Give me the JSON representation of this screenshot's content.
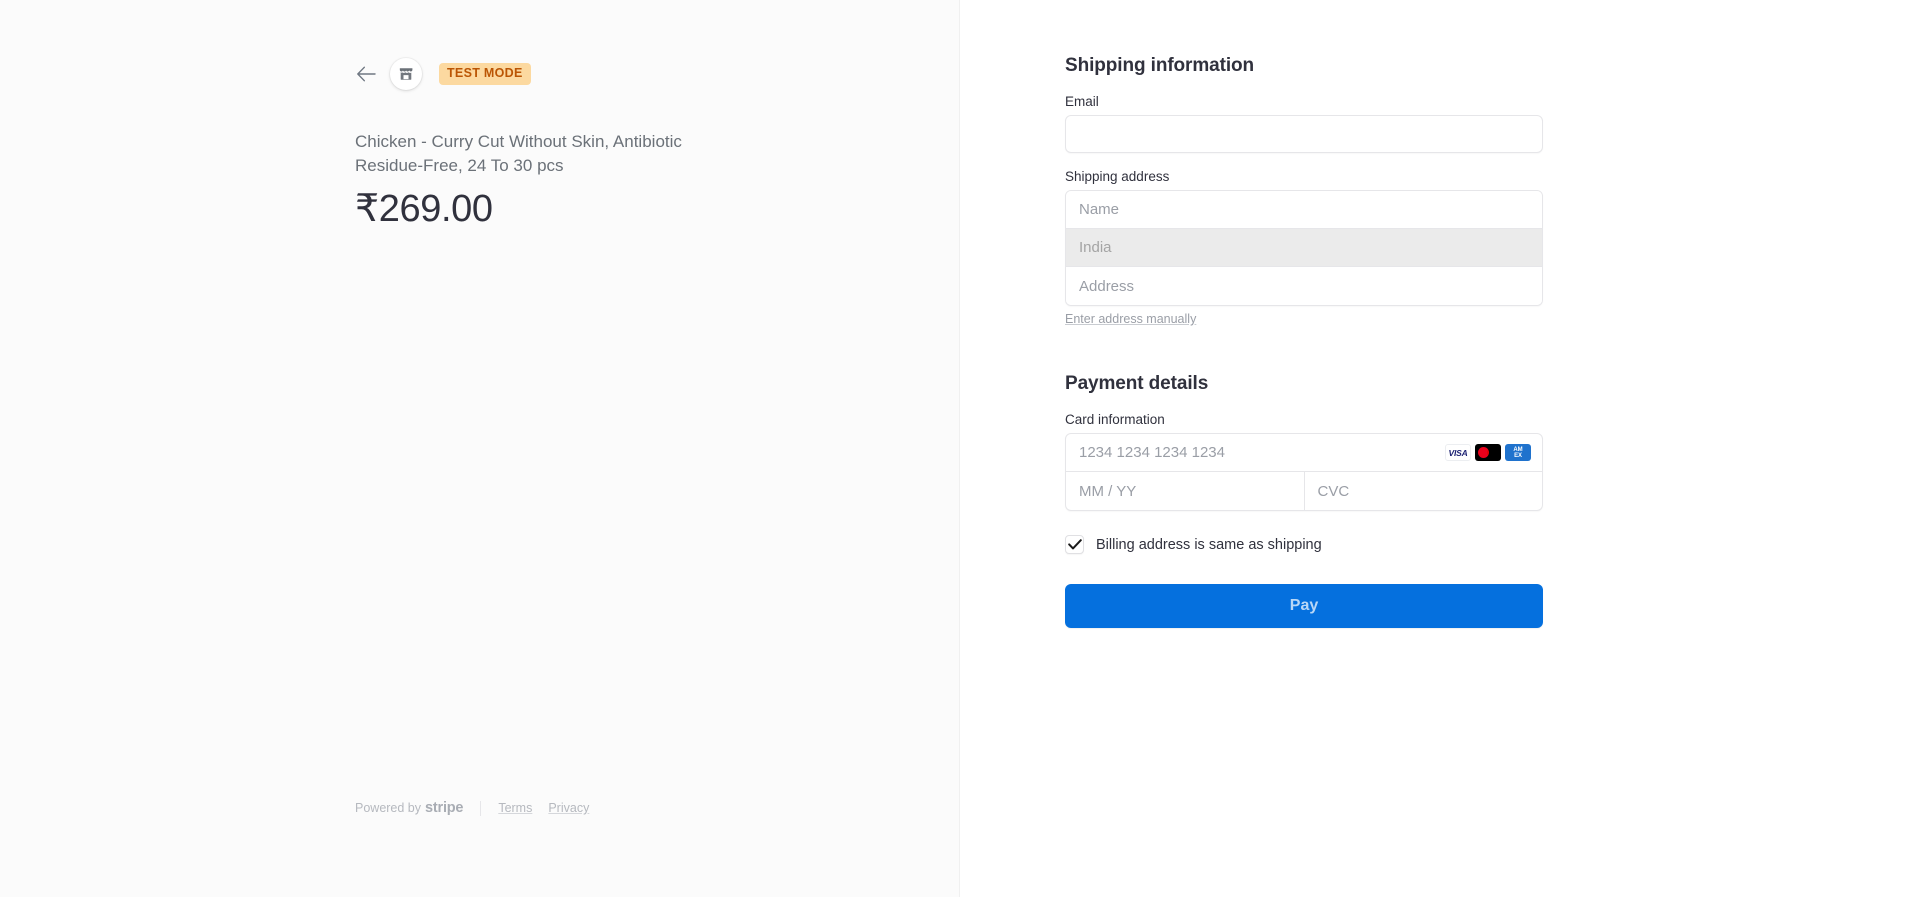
{
  "summary": {
    "back_icon": "back-arrow-icon",
    "merchant_icon": "store-icon",
    "test_mode_badge": "TEST MODE",
    "product_name": "Chicken - Curry Cut Without Skin, Antibiotic Residue-Free, 24 To 30 pcs",
    "price": "₹269.00"
  },
  "footer": {
    "powered_by_text": "Powered by",
    "stripe_word": "stripe",
    "links": [
      {
        "label": "Terms"
      },
      {
        "label": "Privacy"
      }
    ]
  },
  "shipping": {
    "title": "Shipping information",
    "email_label": "Email",
    "email_value": "",
    "email_placeholder": "",
    "address_label": "Shipping address",
    "name_placeholder": "Name",
    "name_value": "",
    "country_placeholder": "India",
    "country_value": "",
    "address_placeholder": "Address",
    "address_value": "",
    "manual_link": "Enter address manually"
  },
  "payment": {
    "title": "Payment details",
    "card_label": "Card information",
    "card_number_placeholder": "1234 1234 1234 1234",
    "card_number_value": "",
    "expiry_placeholder": "MM / YY",
    "expiry_value": "",
    "cvc_placeholder": "CVC",
    "cvc_value": "",
    "brands": [
      {
        "name": "visa",
        "text": "VISA"
      },
      {
        "name": "mastercard",
        "text": ""
      },
      {
        "name": "amex",
        "line1": "AM",
        "line2": "EX"
      }
    ],
    "billing_checkbox_label": "Billing address is same as shipping",
    "billing_checkbox_checked": true,
    "pay_button_label": "Pay"
  },
  "colors": {
    "accent": "#0570de",
    "test_badge_bg": "#fcd9a0",
    "test_badge_text": "#bb5504",
    "text_primary": "#30313d",
    "text_muted": "#6b7178",
    "border": "#e6e6e9"
  }
}
